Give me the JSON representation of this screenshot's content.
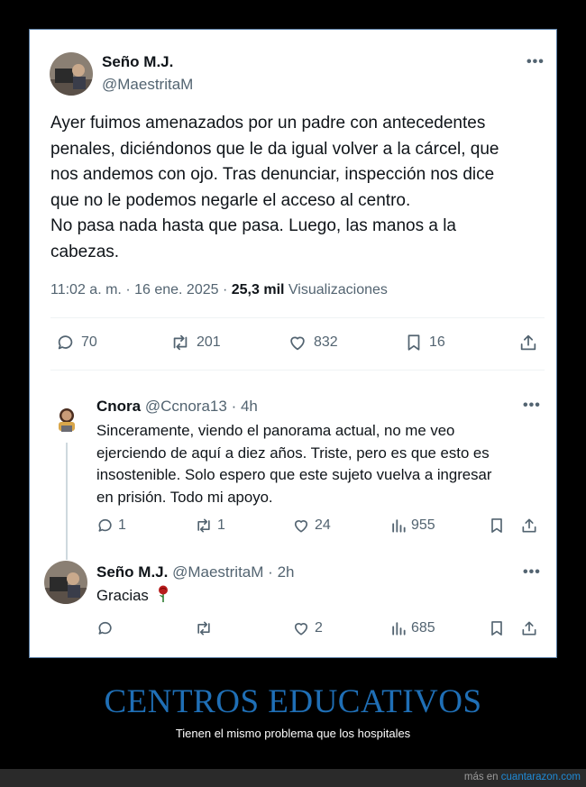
{
  "main_tweet": {
    "author_name": "Seño M.J.",
    "handle": "@MaestritaM",
    "text_lines": [
      "Ayer fuimos amenazados por un padre con antecedentes",
      "penales, diciéndonos que le da igual volver a la cárcel, que",
      "nos andemos con ojo. Tras denunciar, inspección nos dice",
      "que no le podemos negarle el acceso al centro.",
      "No pasa nada hasta que pasa. Luego, las manos a la",
      "cabezas."
    ],
    "time": "11:02 a. m.",
    "date": "16 ene. 2025",
    "views": "25,3 mil",
    "views_label": "Visualizaciones",
    "separator": "·",
    "stats": {
      "replies": "70",
      "retweets": "201",
      "likes": "832",
      "bookmarks": "16"
    }
  },
  "reply1": {
    "author_name": "Cnora",
    "handle": "@Ccnora13",
    "age": "4h",
    "text_lines": [
      "Sinceramente, viendo el panorama actual, no me veo",
      "ejerciendo de aquí a diez años. Triste, pero es que esto es",
      "insostenible. Solo espero que este sujeto vuelva a ingresar",
      "en prisión. Todo mi apoyo."
    ],
    "stats": {
      "replies": "1",
      "retweets": "1",
      "likes": "24",
      "views": "955"
    }
  },
  "reply2": {
    "author_name": "Seño M.J.",
    "handle": "@MaestritaM",
    "age": "2h",
    "text": "Gracias",
    "emoji": "🌹",
    "stats": {
      "likes": "2",
      "views": "685"
    }
  },
  "caption": {
    "title": "CENTROS EDUCATIVOS",
    "subtitle": "Tienen el mismo problema que los hospitales"
  },
  "footer": {
    "prefix": "más en",
    "site": "cuantarazon.com"
  },
  "colors": {
    "text": "#0f1419",
    "secondary": "#536471",
    "caption_blue": "#1f6fb6",
    "link_blue": "#1f8ad6"
  }
}
